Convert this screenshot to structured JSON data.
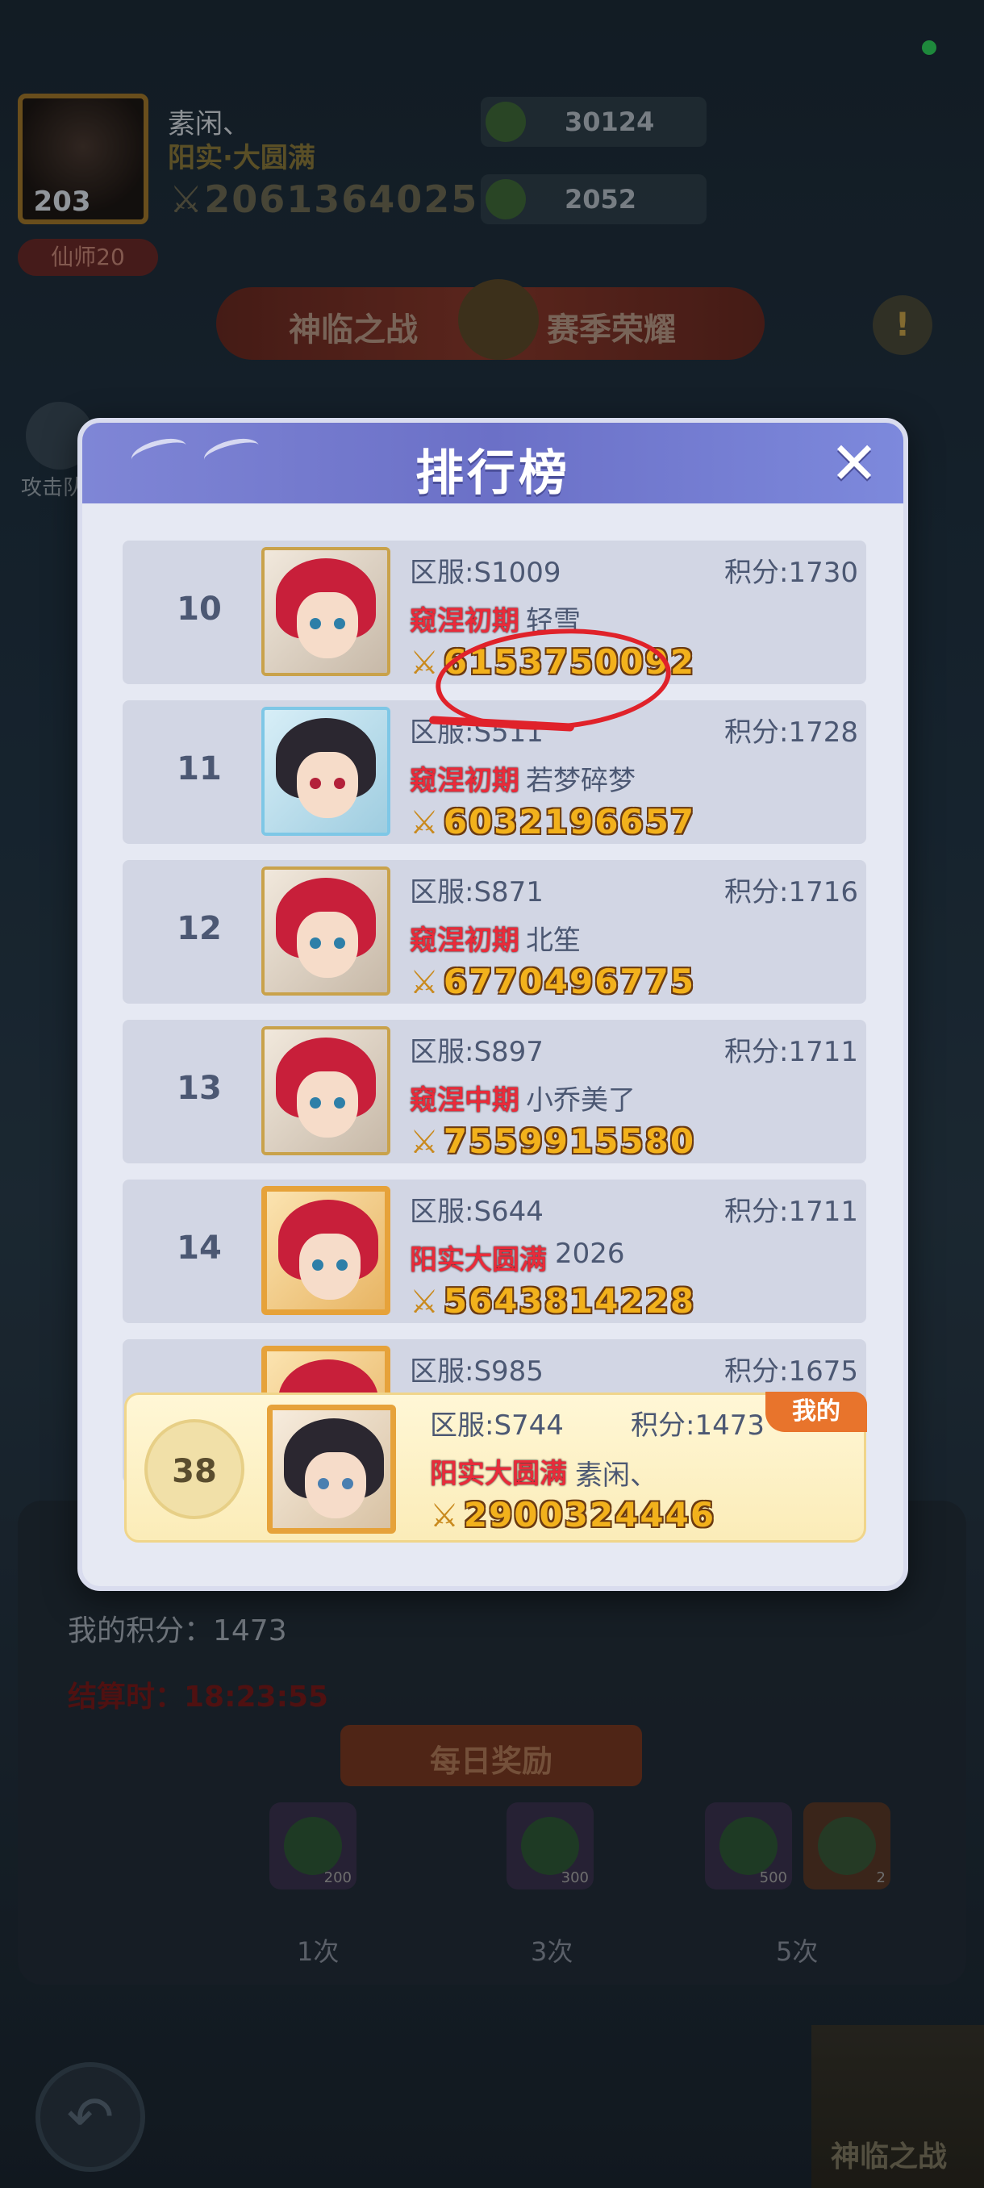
{
  "background": {
    "player": {
      "level": "203",
      "name": "素闲、",
      "realm": "阳实·大圆满",
      "power": "2061364025",
      "title_badge": "仙师20"
    },
    "resources": [
      {
        "icon": "spirit-stone-icon",
        "value": "30124"
      },
      {
        "icon": "herb-icon",
        "value": "2052"
      }
    ],
    "banner": {
      "left": "神临之战",
      "right": "赛季荣耀",
      "alert": "!"
    },
    "tab_label": "攻击队",
    "my_score": "我的积分：1473",
    "timer": "结算时：18:23:55",
    "daily_reward": {
      "label": "每日奖励",
      "items": [
        {
          "count": "200"
        },
        {
          "count": "300"
        },
        {
          "count": "500"
        },
        {
          "count": "2"
        }
      ],
      "times": [
        "1次",
        "3次",
        "5次"
      ]
    },
    "mode_button": "神临之战"
  },
  "leaderboard": {
    "title": "排行榜",
    "close": "✕",
    "rows": [
      {
        "rank": "10",
        "server": "区服:S1009",
        "score": "积分:1730",
        "realm": "窥涅初期",
        "name": "轻雪",
        "power": "6153750092",
        "avatar": "red-hair"
      },
      {
        "rank": "11",
        "server": "区服:S511",
        "score": "积分:1728",
        "realm": "窥涅初期",
        "name": "若梦碎梦",
        "power": "6032196657",
        "avatar": "dark-hair"
      },
      {
        "rank": "12",
        "server": "区服:S871",
        "score": "积分:1716",
        "realm": "窥涅初期",
        "name": "北笙",
        "power": "6770496775",
        "avatar": "red-hair"
      },
      {
        "rank": "13",
        "server": "区服:S897",
        "score": "积分:1711",
        "realm": "窥涅中期",
        "name": "小乔美了",
        "power": "7559915580",
        "avatar": "red-hair"
      },
      {
        "rank": "14",
        "server": "区服:S644",
        "score": "积分:1711",
        "realm": "阳实大圆满",
        "name": "2026",
        "power": "5643814228",
        "avatar": "red-hair-gold"
      },
      {
        "rank": "",
        "server": "区服:S985",
        "score": "积分:1675",
        "realm": "",
        "name": "",
        "power": "",
        "avatar": "red-hair-gold"
      }
    ],
    "mine": {
      "badge": "我的",
      "rank": "38",
      "server": "区服:S744",
      "score": "积分:1473",
      "realm": "阳实大圆满",
      "name": "素闲、",
      "power": "2900324446",
      "avatar": "dark-hair-gold"
    }
  }
}
